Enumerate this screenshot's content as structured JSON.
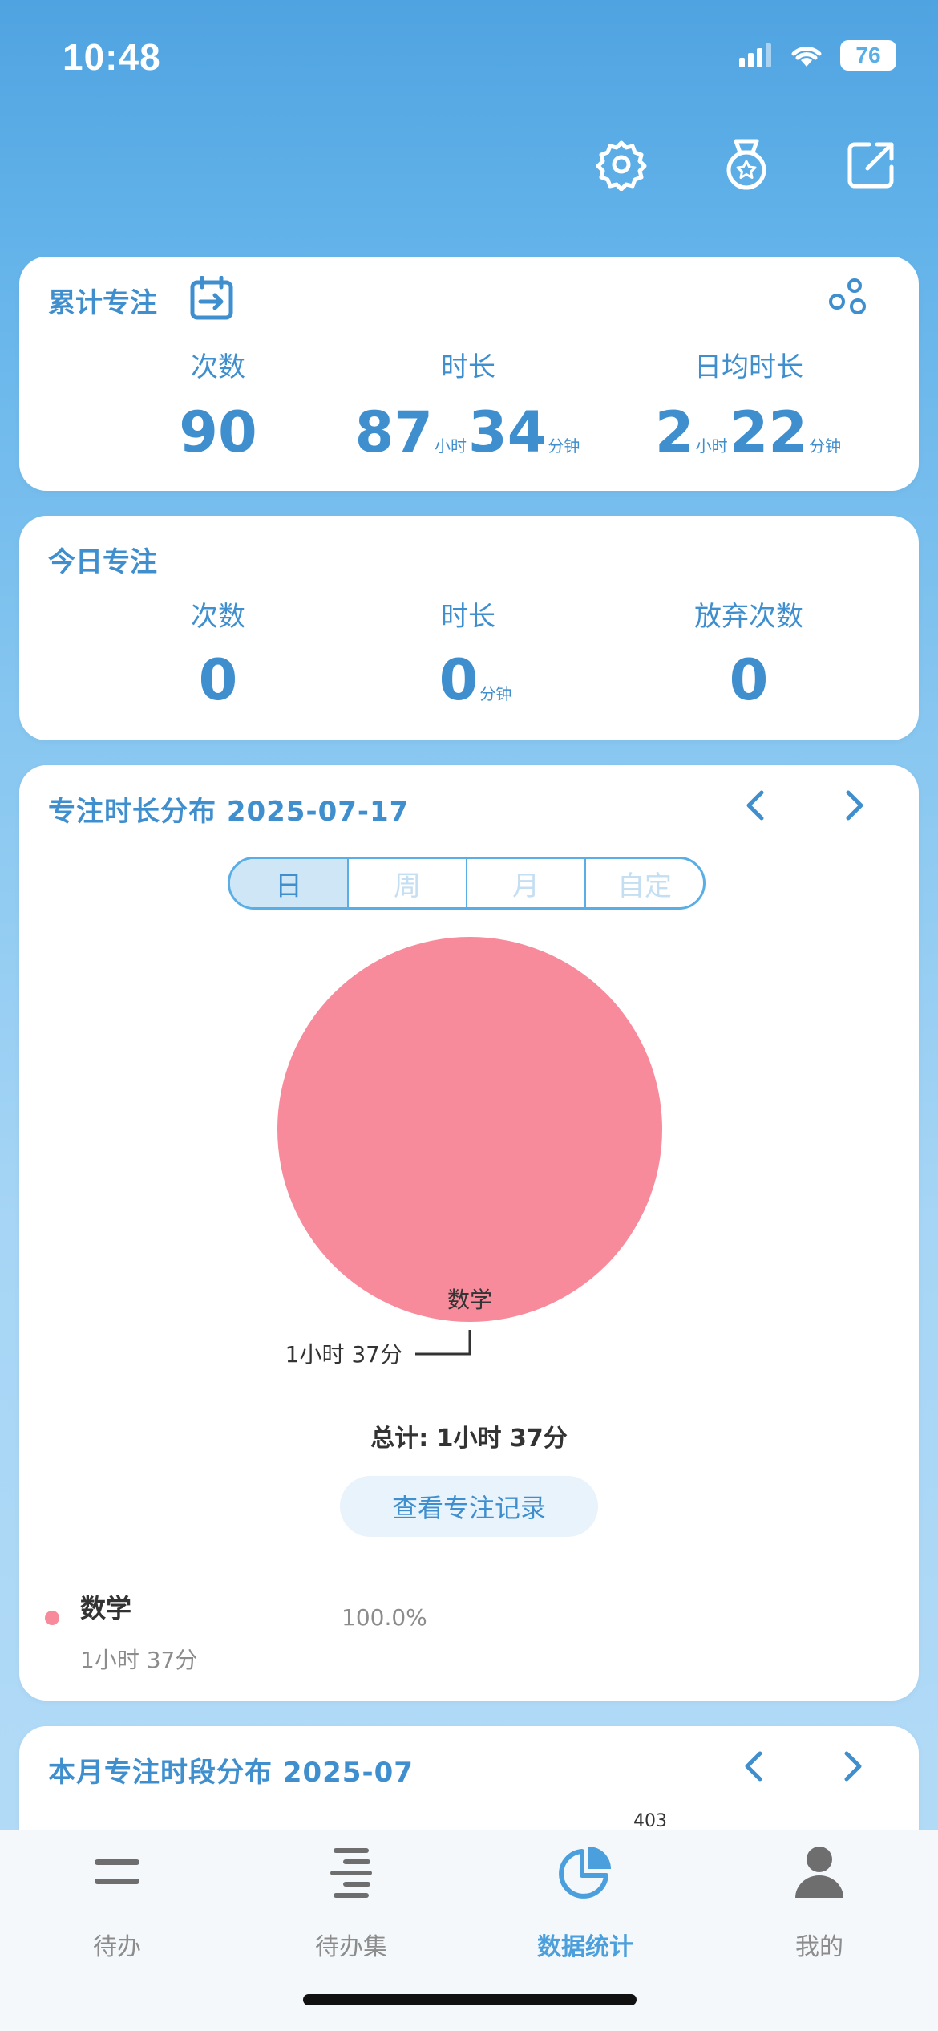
{
  "status_bar": {
    "time": "10:48",
    "battery": "76"
  },
  "cumulative": {
    "title": "累计专注",
    "labels": [
      "次数",
      "时长",
      "日均时长"
    ],
    "count": "90",
    "duration_hours": "87",
    "duration_minutes": "34",
    "daily_hours": "2",
    "daily_minutes": "22",
    "unit_hour": "小时",
    "unit_minute": "分钟"
  },
  "today": {
    "title": "今日专注",
    "labels": [
      "次数",
      "时长",
      "放弃次数"
    ],
    "count": "0",
    "duration_minutes": "0",
    "abandoned": "0",
    "unit_minute": "分钟"
  },
  "distribution": {
    "title": "专注时长分布 2025-07-17",
    "tabs": [
      "日",
      "周",
      "月",
      "自定"
    ],
    "active_tab": "日",
    "total": "总计: 1小时 37分",
    "view_records_button": "查看专注记录",
    "legend": [
      {
        "name": "数学",
        "duration": "1小时 37分",
        "percent": "100.0%",
        "color": "#f78b9b"
      }
    ]
  },
  "chart_data": {
    "type": "pie",
    "slices": [
      {
        "label": "数学",
        "value": 97,
        "value_label": "1小时 37分",
        "color": "#f78b9b"
      }
    ]
  },
  "monthly": {
    "title": "本月专注时段分布  2025-07",
    "overflow_number": "403"
  },
  "tabbar": {
    "items": [
      {
        "label": "待办",
        "icon": "menu-icon"
      },
      {
        "label": "待办集",
        "icon": "list-icon"
      },
      {
        "label": "数据统计",
        "icon": "pie-chart-icon"
      },
      {
        "label": "我的",
        "icon": "user-icon"
      }
    ],
    "active_index": 2
  },
  "colors": {
    "accent": "#3f8fcf",
    "pie": "#f78b9b",
    "inactive": "#8c8c8c"
  }
}
